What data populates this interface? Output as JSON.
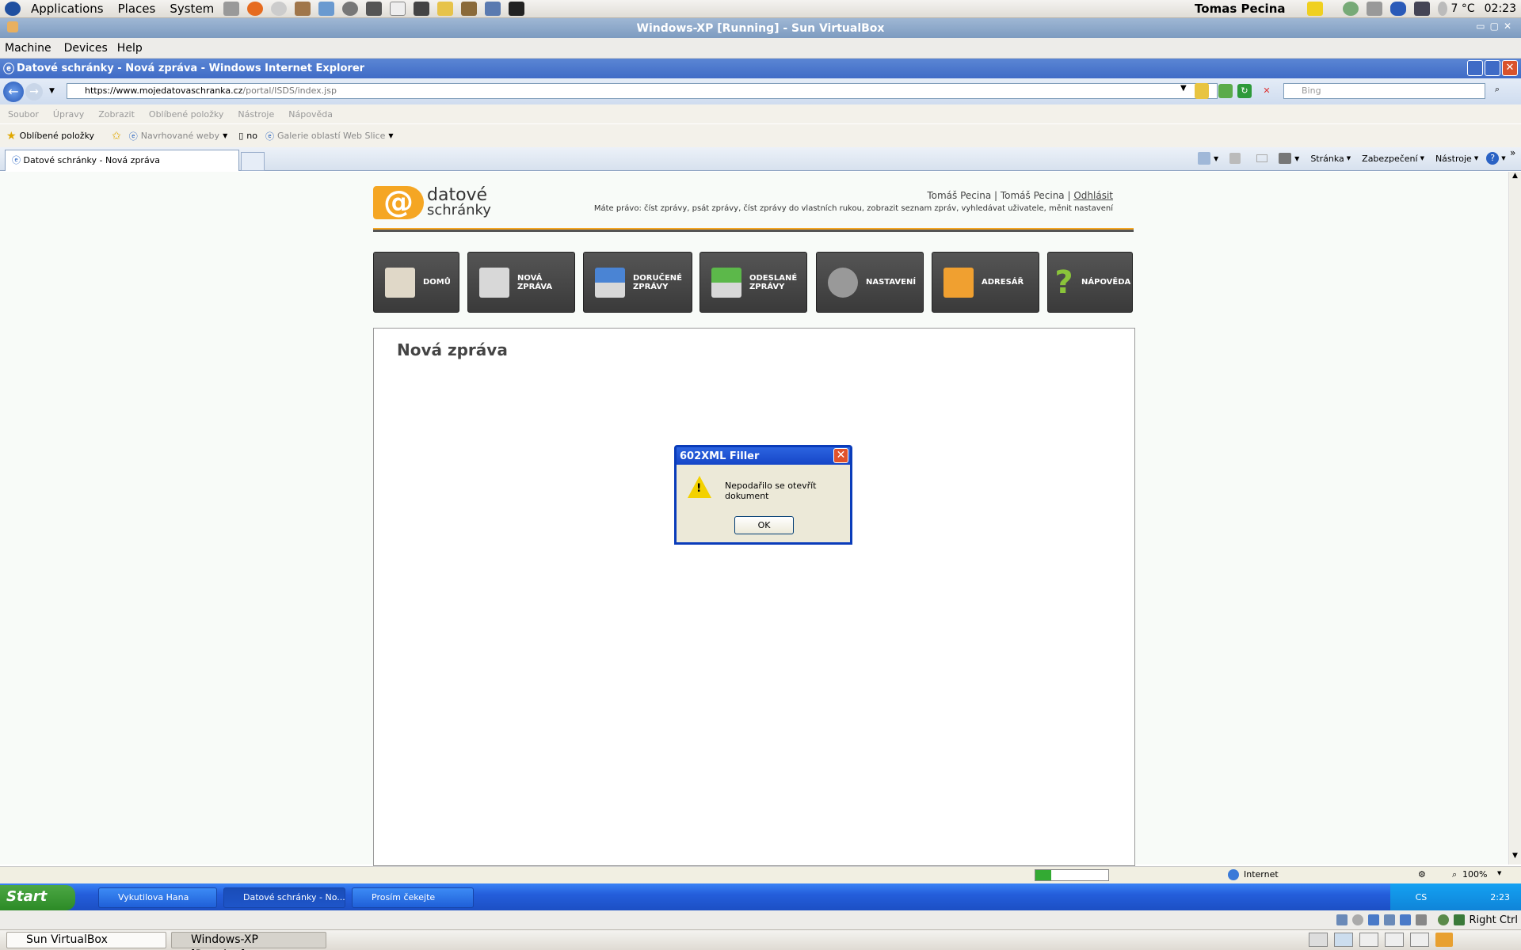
{
  "gnome_panel": {
    "menus": [
      "Applications",
      "Places",
      "System"
    ],
    "user": "Tomas Pecina",
    "weather": "7 °C",
    "clock": "02:23"
  },
  "virtualbox": {
    "title": "Windows-XP [Running] - Sun VirtualBox",
    "menus": [
      "Machine",
      "Devices",
      "Help"
    ],
    "host_key": "Right Ctrl"
  },
  "ie": {
    "title": "Datové schránky - Nová zpráva - Windows Internet Explorer",
    "url_prefix": "https://www.",
    "url_domain": "mojedatovaschranka.cz",
    "url_path": "/portal/ISDS/index.jsp",
    "search_placeholder": "Bing",
    "menus": [
      "Soubor",
      "Úpravy",
      "Zobrazit",
      "Oblíbené položky",
      "Nástroje",
      "Nápověda"
    ],
    "favorites": {
      "label": "Oblíbené položky",
      "suggested": "Navrhované weby",
      "no": "no",
      "gallery": "Galerie oblastí Web Slice"
    },
    "tab_label": "Datové schránky - Nová zpráva",
    "commands": [
      "Stránka",
      "Zabezpečení",
      "Nástroje"
    ],
    "status": {
      "zone": "Internet",
      "zoom": "100%"
    }
  },
  "page": {
    "logo_at": "@",
    "logo_line1": "datové",
    "logo_line2": "schránky",
    "user_line_a": "Tomáš Pecina | Tomáš Pecina | ",
    "logout": "Odhlásit",
    "rights": "Máte právo: číst zprávy, psát zprávy, číst zprávy do vlastních rukou, zobrazit seznam zpráv, vyhledávat uživatele, měnit nastavení",
    "nav": [
      {
        "label1": "DOMŮ",
        "label2": ""
      },
      {
        "label1": "NOVÁ",
        "label2": "ZPRÁVA"
      },
      {
        "label1": "DORUČENÉ",
        "label2": "ZPRÁVY"
      },
      {
        "label1": "ODESLANÉ",
        "label2": "ZPRÁVY"
      },
      {
        "label1": "NASTAVENÍ",
        "label2": ""
      },
      {
        "label1": "ADRESÁŘ",
        "label2": ""
      },
      {
        "label1": "NÁPOVĚDA",
        "label2": ""
      }
    ],
    "heading": "Nová zpráva"
  },
  "dialog": {
    "title": "602XML Filler",
    "message": "Nepodařilo se otevřít dokument",
    "ok": "OK",
    "close": "✕"
  },
  "xp_taskbar": {
    "start": "Start",
    "buttons": [
      "Vykutilova Hana",
      "Datové schránky - No...",
      "Prosím čekejte"
    ],
    "lang": "CS",
    "clock": "2:23"
  },
  "gnome_taskbar": {
    "buttons": [
      "Sun VirtualBox",
      "Windows-XP [Running]..."
    ]
  },
  "colors": {
    "accent": "#f5a623",
    "nav_button": "#444444",
    "xp_blue": "#245edb"
  }
}
